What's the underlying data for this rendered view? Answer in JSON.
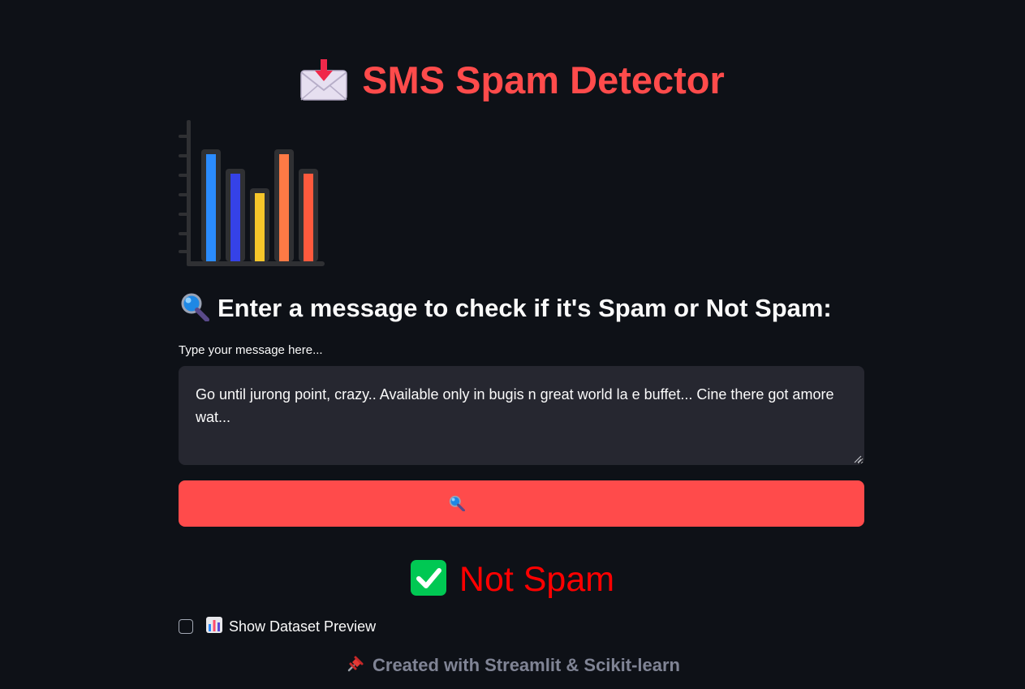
{
  "app": {
    "title": "SMS Spam Detector",
    "title_icon": "incoming-envelope-icon",
    "illustration_icon": "bar-chart-illustration",
    "bar_colors": [
      "#2b8cff",
      "#3542e8",
      "#f7c62a",
      "#ff7a45",
      "#ff5a3d"
    ]
  },
  "prompt": {
    "heading": "Enter a message to check if it's Spam or Not Spam:",
    "heading_icon": "magnifier-icon"
  },
  "input": {
    "label": "Type your message here...",
    "value": "Go until jurong point, crazy.. Available only in bugis n great world la e buffet... Cine there got amore wat..."
  },
  "check_button": {
    "icon": "magnifier-icon",
    "color": "#ff4b4b"
  },
  "result": {
    "label": "Not Spam",
    "icon": "check-mark-icon",
    "icon_color": "#00c853",
    "text_color": "#ff0000"
  },
  "dataset_preview": {
    "label": "Show Dataset Preview",
    "icon": "bar-chart-icon",
    "checked": false
  },
  "footer": {
    "text": "Created with Streamlit & Scikit-learn",
    "icon": "pushpin-icon"
  },
  "colors": {
    "background": "#0e1117",
    "accent": "#ff4b4b",
    "input_bg": "#262730",
    "muted_text": "#808495"
  }
}
